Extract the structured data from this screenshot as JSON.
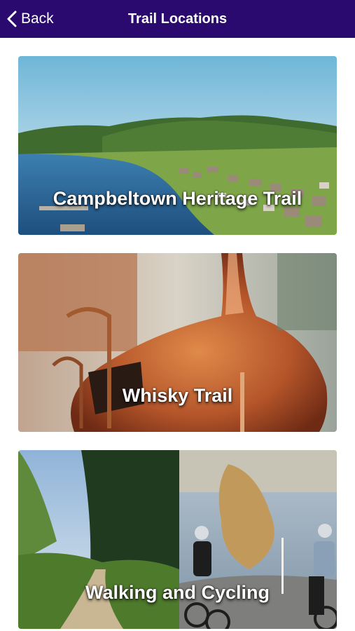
{
  "header": {
    "title": "Trail Locations",
    "back_label": "Back",
    "background": "#2a0a6e"
  },
  "trails": [
    {
      "label": "Campbeltown Heritage Trail",
      "image": "coastal-town-landscape"
    },
    {
      "label": "Whisky Trail",
      "image": "copper-still"
    },
    {
      "label": "Walking and Cycling",
      "image": "forest-path-and-cyclists"
    }
  ]
}
